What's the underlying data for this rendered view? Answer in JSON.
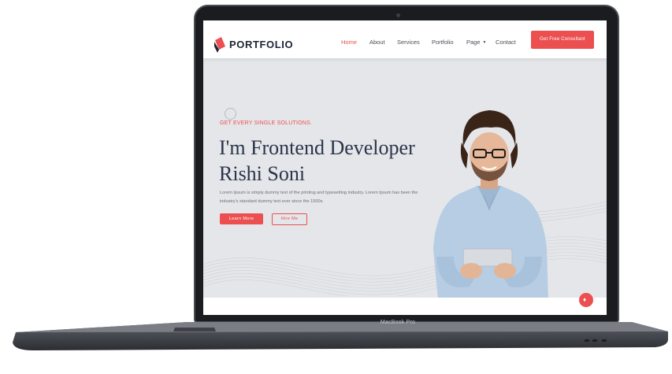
{
  "device": {
    "label": "MacBook Pro"
  },
  "header": {
    "logo_text": "PORTFOLIO",
    "nav": [
      {
        "label": "Home",
        "active": true
      },
      {
        "label": "About",
        "active": false
      },
      {
        "label": "Services",
        "active": false
      },
      {
        "label": "Portfolio",
        "active": false
      },
      {
        "label": "Page",
        "active": false,
        "has_dropdown": true
      },
      {
        "label": "Contact",
        "active": false
      }
    ],
    "cta_label": "Get Free Consultant"
  },
  "hero": {
    "tagline": "GET EVERY SINGLE SOLUTIONS.",
    "headline_line1": "I'm Frontend Developer",
    "headline_line2": "Rishi Soni",
    "description": "Lorem Ipsum is simply dummy text of the printing and typesetting industry. Lorem Ipsum has been the industry's standard dummy text ever since the 1500s.",
    "primary_button": "Learn More",
    "secondary_button": "Hire Me"
  },
  "colors": {
    "accent": "#ec4f4f",
    "heading": "#2b3449",
    "hero_bg": "#e4e6e9",
    "bezel": "#1b1c1f"
  },
  "icons": {
    "logo": "portfolio-logo-icon",
    "fab": "fire-icon",
    "dropdown": "caret-down-icon"
  }
}
